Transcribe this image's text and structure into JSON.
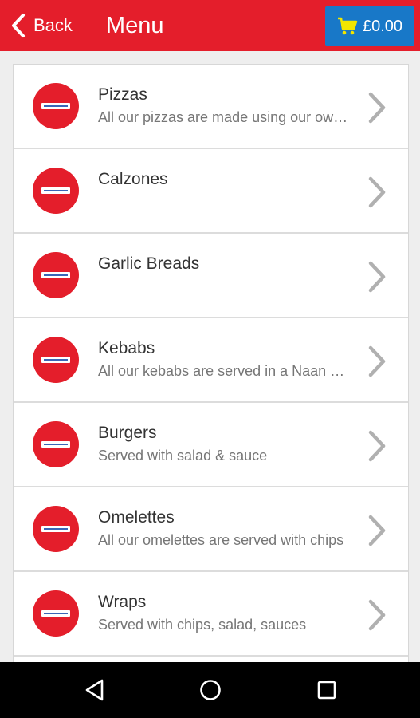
{
  "header": {
    "back_label": "Back",
    "title": "Menu",
    "cart_total": "£0.00"
  },
  "menu": {
    "items": [
      {
        "name": "Pizzas",
        "desc": "All our pizzas are made using our own fresh dough"
      },
      {
        "name": "Calzones",
        "desc": ""
      },
      {
        "name": "Garlic Breads",
        "desc": ""
      },
      {
        "name": "Kebabs",
        "desc": "All our kebabs are served in a Naan bread"
      },
      {
        "name": "Burgers",
        "desc": "Served with salad & sauce"
      },
      {
        "name": "Omelettes",
        "desc": "All our omelettes are served with chips"
      },
      {
        "name": "Wraps",
        "desc": "Served with chips, salad, sauces"
      }
    ]
  },
  "colors": {
    "header_bg": "#e41e2b",
    "cart_bg": "#1878c8",
    "cart_icon": "#f2e600",
    "logo_bg": "#e41e2b"
  },
  "icons": {
    "back": "chevron-left-icon",
    "cart": "shopping-cart-icon",
    "item_arrow": "chevron-right-icon",
    "nav_back": "triangle-back-icon",
    "nav_home": "circle-home-icon",
    "nav_recents": "square-recents-icon"
  }
}
